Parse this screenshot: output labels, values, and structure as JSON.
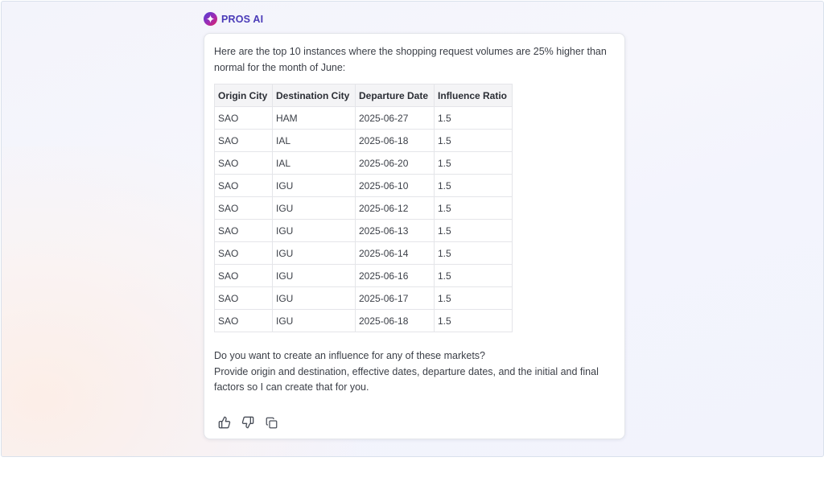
{
  "brand": {
    "name": "PROS AI",
    "logo_icon": "sparkle-icon",
    "gradient_colors": [
      "#4b3fd6",
      "#a02bb3",
      "#e0245e"
    ]
  },
  "message": {
    "intro": "Here are the top 10 instances where the shopping request volumes are 25% higher than normal for the month of June:",
    "table": {
      "headers": [
        "Origin City",
        "Destination City",
        "Departure Date",
        "Influence Ratio"
      ],
      "rows": [
        [
          "SAO",
          "HAM",
          "2025-06-27",
          "1.5"
        ],
        [
          "SAO",
          "IAL",
          "2025-06-18",
          "1.5"
        ],
        [
          "SAO",
          "IAL",
          "2025-06-20",
          "1.5"
        ],
        [
          "SAO",
          "IGU",
          "2025-06-10",
          "1.5"
        ],
        [
          "SAO",
          "IGU",
          "2025-06-12",
          "1.5"
        ],
        [
          "SAO",
          "IGU",
          "2025-06-13",
          "1.5"
        ],
        [
          "SAO",
          "IGU",
          "2025-06-14",
          "1.5"
        ],
        [
          "SAO",
          "IGU",
          "2025-06-16",
          "1.5"
        ],
        [
          "SAO",
          "IGU",
          "2025-06-17",
          "1.5"
        ],
        [
          "SAO",
          "IGU",
          "2025-06-18",
          "1.5"
        ]
      ]
    },
    "followup_line1": "Do you want to create an influence for any of these markets?",
    "followup_line2": "Provide origin and destination, effective dates, departure dates, and the initial and final factors so I can create that for you."
  },
  "actions": [
    {
      "name": "thumbs-up-button",
      "icon": "thumbs-up-icon"
    },
    {
      "name": "thumbs-down-button",
      "icon": "thumbs-down-icon"
    },
    {
      "name": "copy-button",
      "icon": "copy-icon"
    }
  ],
  "colors": {
    "brand_text": "#4a3bb8",
    "body_text": "#3b3f47",
    "table_header_bg": "#f4f4f6",
    "border": "#e4e5e9"
  }
}
